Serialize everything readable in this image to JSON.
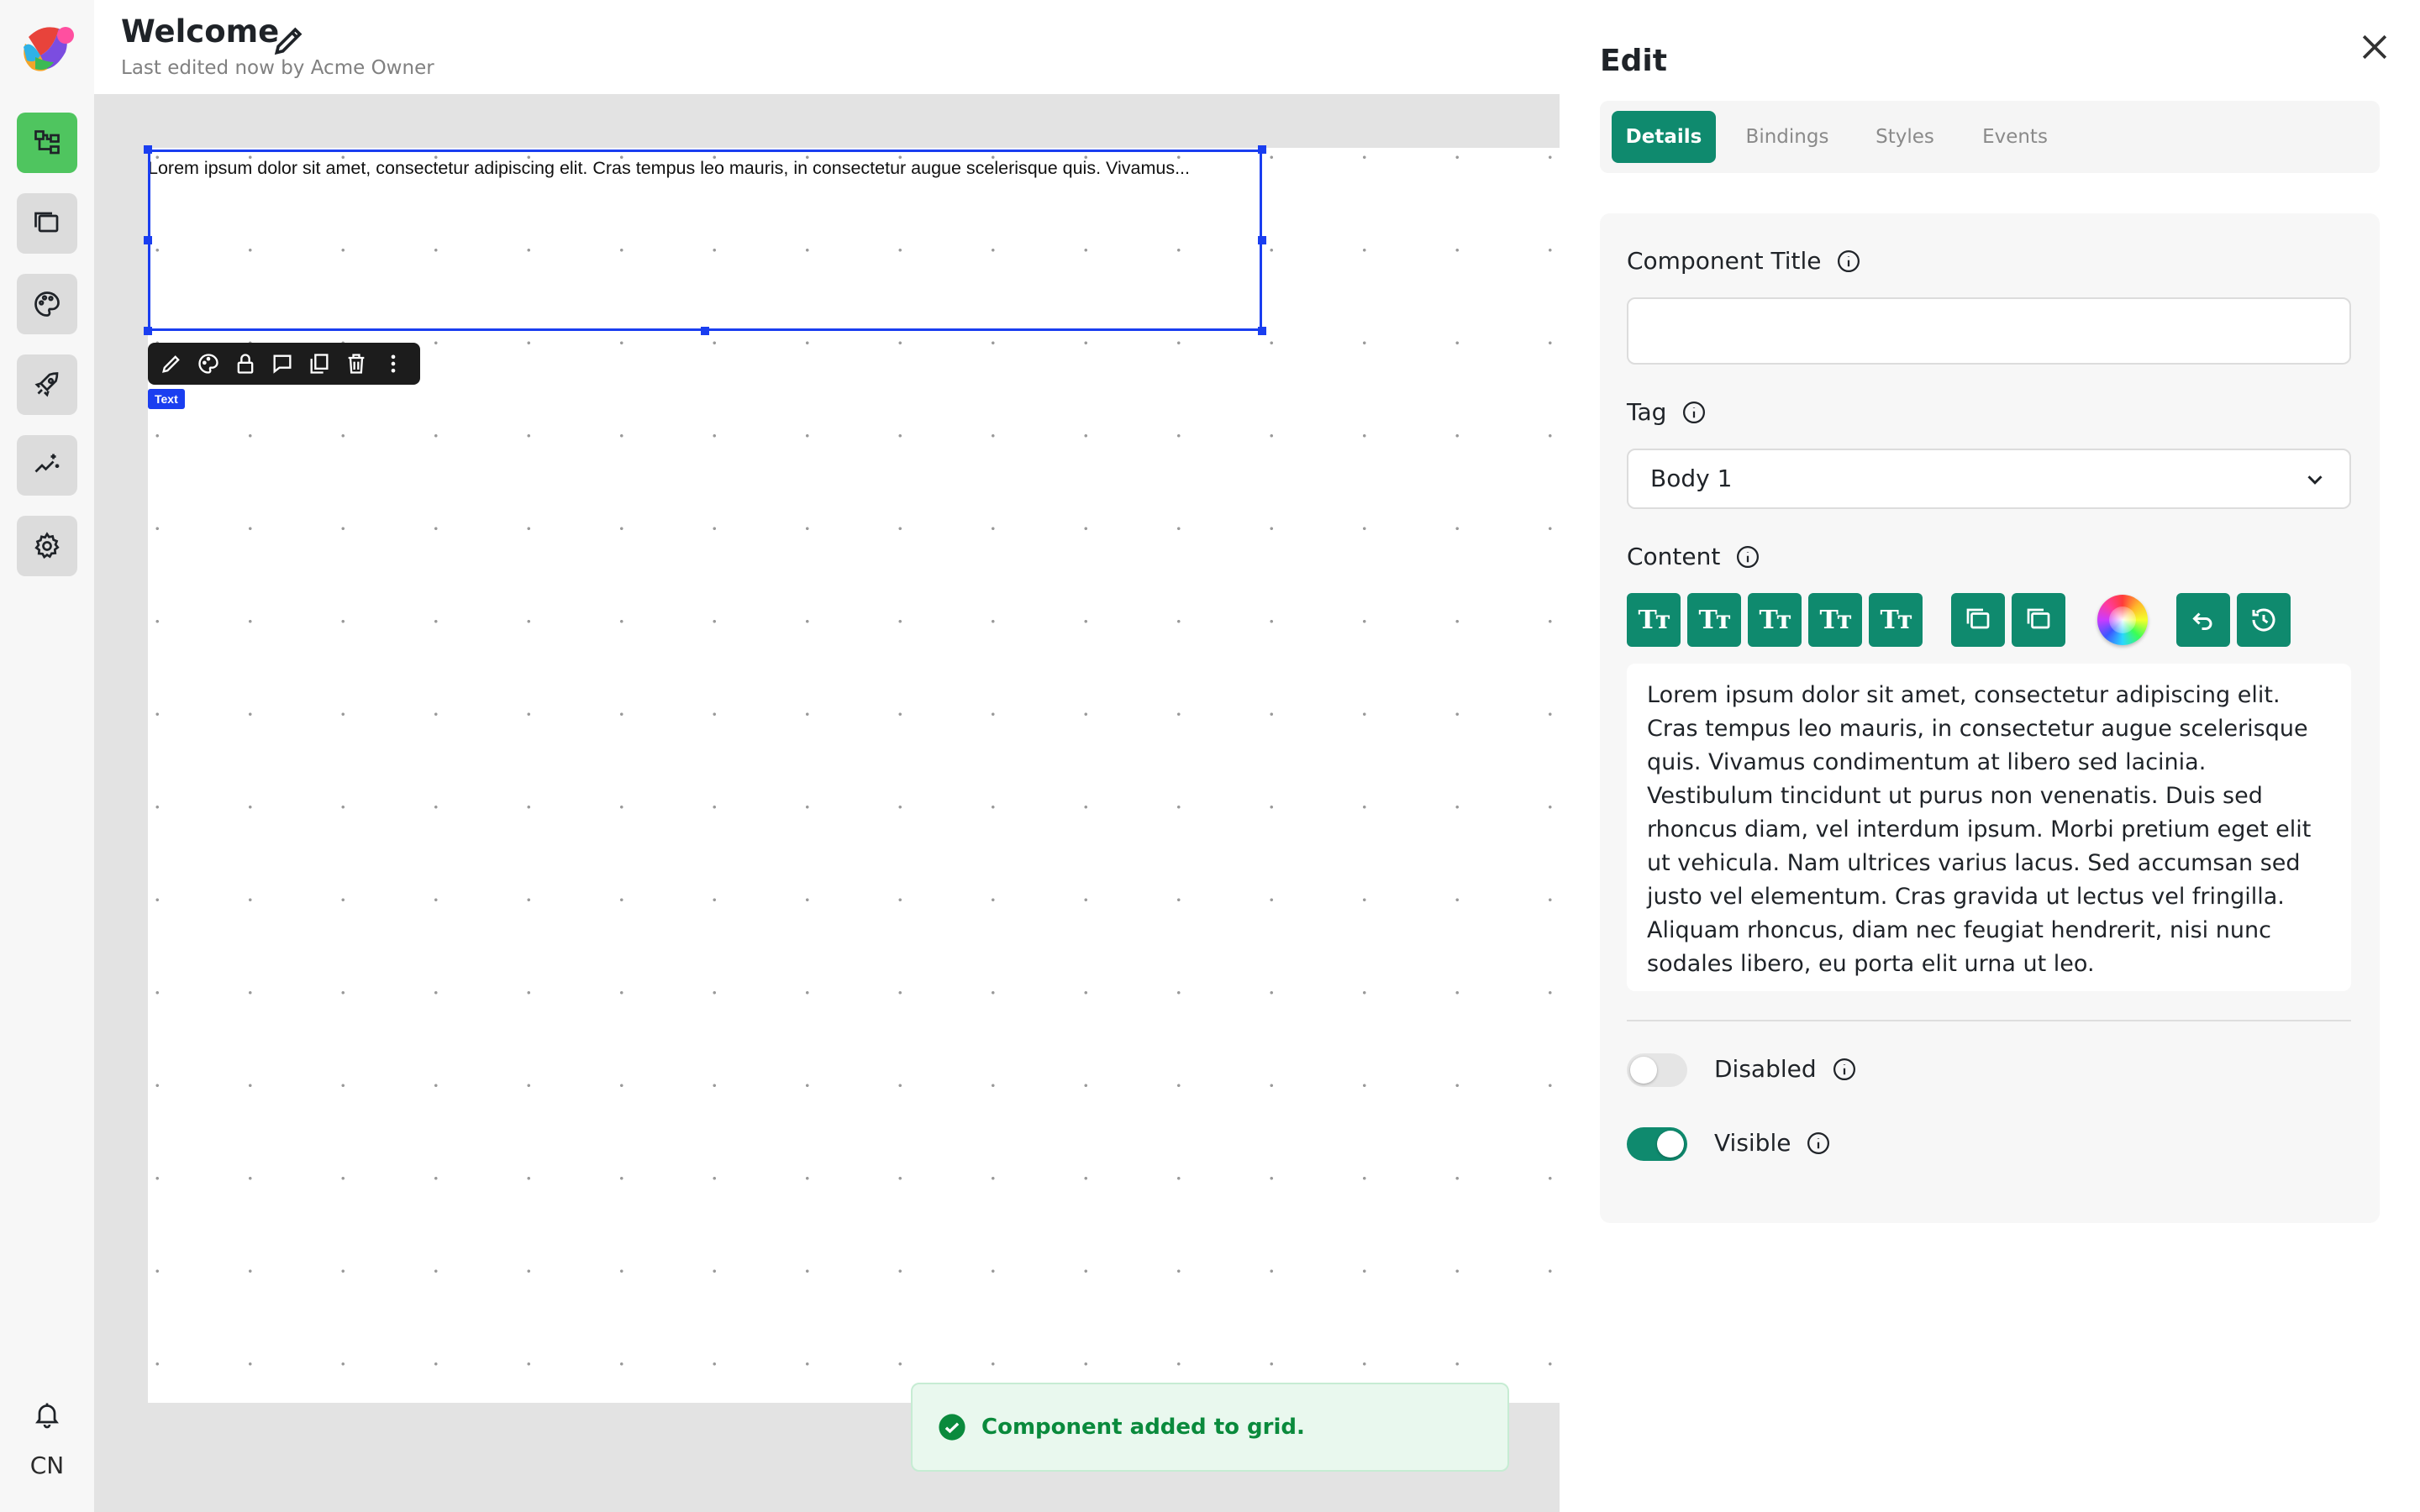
{
  "header": {
    "title": "Welcome",
    "subtitle": "Last edited now by Acme Owner"
  },
  "sidebar": {
    "items": [
      {
        "icon": "component-tree-icon",
        "active": true
      },
      {
        "icon": "pages-icon",
        "active": false
      },
      {
        "icon": "palette-icon",
        "active": false
      },
      {
        "icon": "rocket-icon",
        "active": false
      },
      {
        "icon": "magic-wand-icon",
        "active": false
      },
      {
        "icon": "settings-gear-icon",
        "active": false
      }
    ],
    "locale": "CN"
  },
  "canvas": {
    "selected_text": "Lorem ipsum dolor sit amet, consectetur adipiscing elit. Cras tempus leo mauris, in consectetur augue scelerisque quis. Vivamus...",
    "component_type": "Text",
    "toolbar_icons": [
      "pencil-icon",
      "palette-icon",
      "lock-icon",
      "comment-icon",
      "duplicate-icon",
      "trash-icon",
      "more-vertical-icon"
    ]
  },
  "toast": {
    "message": "Component added to grid."
  },
  "panel": {
    "title": "Edit",
    "tabs": [
      {
        "label": "Details",
        "active": true
      },
      {
        "label": "Bindings",
        "active": false
      },
      {
        "label": "Styles",
        "active": false
      },
      {
        "label": "Events",
        "active": false
      }
    ],
    "component_title": {
      "label": "Component Title",
      "value": ""
    },
    "tag": {
      "label": "Tag",
      "value": "Body 1"
    },
    "content": {
      "label": "Content",
      "text": "Lorem ipsum dolor sit amet, consectetur adipiscing elit. Cras tempus leo mauris, in consectetur augue scelerisque quis. Vivamus condimentum at libero sed lacinia. Vestibulum tincidunt ut purus non venenatis. Duis sed rhoncus diam, vel interdum ipsum. Morbi pretium eget elit ut vehicula. Nam ultrices varius lacus. Sed accumsan sed justo vel elementum. Cras gravida ut lectus vel fringilla. Aliquam rhoncus, diam nec feugiat hendrerit, nisi nunc sodales libero, eu porta elit urna ut leo.",
      "format_buttons": [
        "Tт",
        "Tт",
        "Tт",
        "Tт",
        "Tт"
      ]
    },
    "disabled": {
      "label": "Disabled",
      "on": false
    },
    "visible": {
      "label": "Visible",
      "on": true
    }
  },
  "colors": {
    "accent": "#0f8a6e",
    "sidebar_active": "#4fc55f",
    "selection": "#1a3ef0",
    "toast_text": "#0a8a3c"
  }
}
